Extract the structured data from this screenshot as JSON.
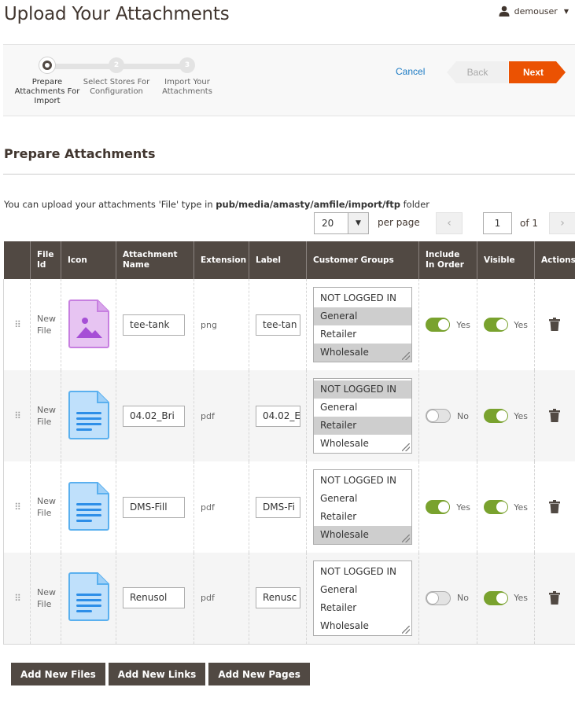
{
  "page": {
    "title": "Upload Your Attachments",
    "user": "demouser"
  },
  "wizard": {
    "steps": [
      {
        "num": "",
        "label": "Prepare Attachments For Import"
      },
      {
        "num": "2",
        "label": "Select Stores For Configuration"
      },
      {
        "num": "3",
        "label": "Import Your Attachments"
      }
    ],
    "cancel": "Cancel",
    "back": "Back",
    "next": "Next"
  },
  "section": {
    "title": "Prepare Attachments",
    "note_prefix": "You can upload your attachments 'File' type in ",
    "note_path": "pub/media/amasty/amfile/import/ftp",
    "note_suffix": " folder"
  },
  "pager": {
    "per_page_value": "20",
    "per_page_label": "per page",
    "page": "1",
    "of": "of 1"
  },
  "grid": {
    "headers": [
      "File Id",
      "Icon",
      "Attachment Name",
      "Extension",
      "Label",
      "Customer Groups",
      "Include In Order",
      "Visible",
      "Actions"
    ],
    "groups": [
      "NOT LOGGED IN",
      "General",
      "Retailer",
      "Wholesale"
    ],
    "rows": [
      {
        "file_id": "New File",
        "icon": "image-file-icon",
        "name": "tee-tank",
        "extension": "png",
        "label": "tee-tan",
        "selected": [
          false,
          true,
          false,
          true
        ],
        "include": "Yes",
        "include_on": true,
        "visible": "Yes",
        "visible_on": true
      },
      {
        "file_id": "New File",
        "icon": "document-file-icon",
        "name": "04.02_Bri",
        "extension": "pdf",
        "label": "04.02_E",
        "selected": [
          true,
          false,
          true,
          false
        ],
        "include": "No",
        "include_on": false,
        "visible": "Yes",
        "visible_on": true
      },
      {
        "file_id": "New File",
        "icon": "document-file-icon",
        "name": "DMS-Fill",
        "extension": "pdf",
        "label": "DMS-Fi",
        "selected": [
          false,
          false,
          false,
          true
        ],
        "include": "Yes",
        "include_on": true,
        "visible": "Yes",
        "visible_on": true
      },
      {
        "file_id": "New File",
        "icon": "document-file-icon",
        "name": "Renusol",
        "extension": "pdf",
        "label": "Renusc",
        "selected": [
          false,
          false,
          false,
          false
        ],
        "include": "No",
        "include_on": false,
        "visible": "Yes",
        "visible_on": true
      }
    ]
  },
  "actions": {
    "add_files": "Add New Files",
    "add_links": "Add New Links",
    "add_pages": "Add New Pages"
  },
  "colors": {
    "accent": "#eb5202",
    "header_bg": "#514943",
    "toggle_on": "#79a22e",
    "link": "#1979c3"
  }
}
